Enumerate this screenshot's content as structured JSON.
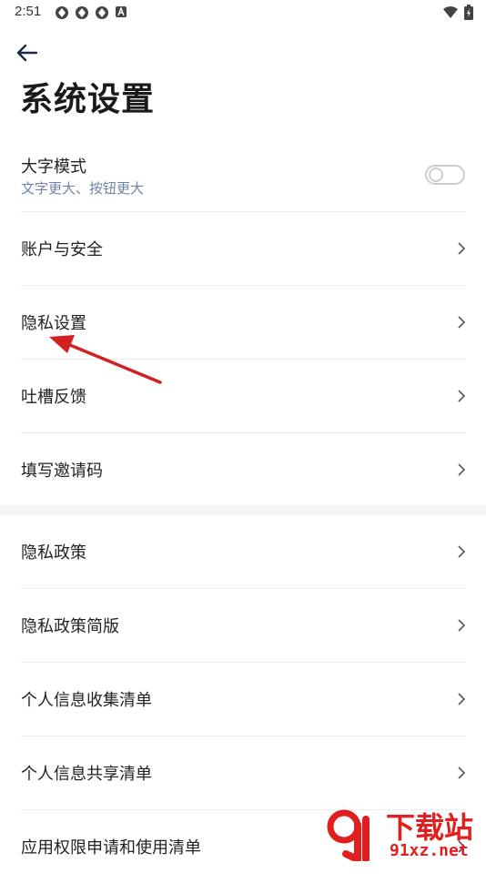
{
  "status_bar": {
    "time": "2:51",
    "left_icons": [
      "app-notification-icon",
      "app-notification-icon",
      "app-notification-icon",
      "a-letter-icon"
    ],
    "right_icons": [
      "wifi-icon",
      "battery-icon"
    ]
  },
  "header": {
    "back_icon": "arrow-left-icon",
    "title": "系统设置"
  },
  "large_font": {
    "title": "大字模式",
    "subtitle": "文字更大、按钮更大",
    "enabled": false
  },
  "group1": [
    {
      "label": "账户与安全"
    },
    {
      "label": "隐私设置"
    },
    {
      "label": "吐槽反馈"
    },
    {
      "label": "填写邀请码"
    }
  ],
  "group2": [
    {
      "label": "隐私政策"
    },
    {
      "label": "隐私政策简版"
    },
    {
      "label": "个人信息收集清单"
    },
    {
      "label": "个人信息共享清单"
    },
    {
      "label": "应用权限申请和使用清单"
    }
  ],
  "watermark": {
    "line1": "下载站",
    "line2": "91xz.net"
  },
  "colors": {
    "subtitle": "#6f83a8",
    "annotation_arrow": "#d42020",
    "section_gap": "#f3f4f6"
  }
}
